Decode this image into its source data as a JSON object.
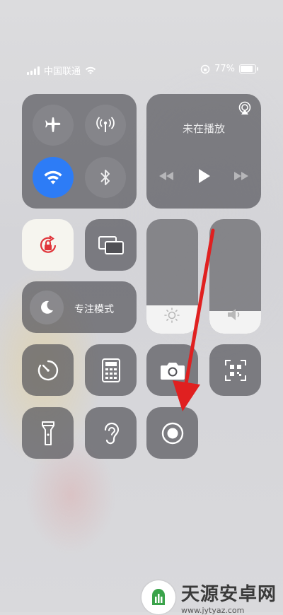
{
  "status_bar": {
    "carrier": "中国联通",
    "battery_percent": "77%",
    "battery_level": 0.77
  },
  "connectivity": {
    "airplane_mode": false,
    "cellular_data": false,
    "wifi": true,
    "bluetooth": false
  },
  "now_playing": {
    "title": "未在播放"
  },
  "focus": {
    "label": "专注模式"
  },
  "sliders": {
    "brightness_level": 0.25,
    "volume_level": 0.2
  },
  "colors": {
    "wifi_active": "#2d7cf6",
    "orientation_lock": "#e0343a",
    "arrow": "#e02020"
  },
  "watermark": {
    "brand": "天源安卓网",
    "url": "www.jytyaz.com"
  }
}
